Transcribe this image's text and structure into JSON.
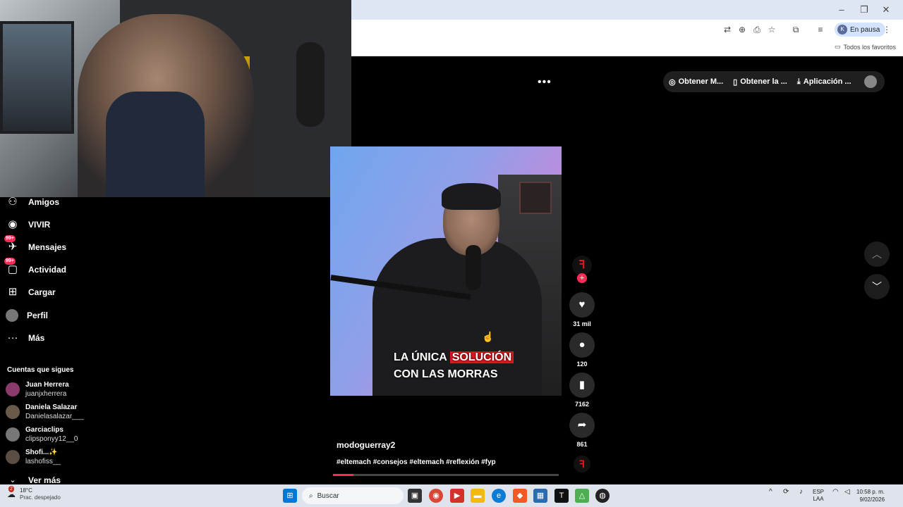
{
  "browser": {
    "pause_label": "En pausa",
    "pause_avatar": "K",
    "favorites_label": "Todos los favoritos",
    "window_controls": {
      "minimize": "–",
      "maximize": "❐",
      "close": "✕"
    },
    "toolbar_icons": [
      "translate-icon",
      "zoom-icon",
      "install-icon",
      "star-icon",
      "extensions-icon",
      "media-icon",
      "menu-icon"
    ]
  },
  "header": {
    "more_label": "•••",
    "buttons": [
      {
        "label": "Obtener M...",
        "icon": "coin-icon"
      },
      {
        "label": "Obtener la ...",
        "icon": "phone-icon"
      },
      {
        "label": "Aplicación ...",
        "icon": "download-icon"
      }
    ]
  },
  "sidebar": {
    "items": [
      {
        "label": "Amigos",
        "icon": "friends-icon"
      },
      {
        "label": "VIVIR",
        "icon": "live-icon"
      },
      {
        "label": "Mensajes",
        "icon": "messages-icon",
        "badge": "99+"
      },
      {
        "label": "Actividad",
        "icon": "activity-icon",
        "badge": "99+"
      },
      {
        "label": "Cargar",
        "icon": "upload-icon"
      },
      {
        "label": "Perfil",
        "icon": "profile-icon"
      },
      {
        "label": "Más",
        "icon": "more-icon"
      }
    ],
    "following_title": "Cuentas que sigues",
    "following": [
      {
        "name": "Juan Herrera",
        "user": "juanjxherrera"
      },
      {
        "name": "Daniela Salazar",
        "user": "Danielasalazar___"
      },
      {
        "name": "Garciaclips",
        "user": "clipsponyy12__0"
      },
      {
        "name": "Shofi...✨",
        "user": "lashofiss__"
      }
    ],
    "see_more": "Ver más"
  },
  "video": {
    "caption_line1_a": "LA ÚNICA",
    "caption_line1_b": "SOLUCIÓN",
    "caption_line2": "CON LAS MORRAS",
    "author": "modoguerray2",
    "tags": "#eltemach #consejos #eltemach #reflexión #fyp",
    "progress": 0.09
  },
  "actions": {
    "likes": "31 mil",
    "comments": "120",
    "saves": "7162",
    "shares": "861"
  },
  "taskbar": {
    "weather_badge": "2",
    "temperature": "18°C",
    "weather_desc": "Prac. despejado",
    "search_label": "Buscar",
    "lang_top": "ESP",
    "lang_bottom": "LAA",
    "time": "10:58 p. m.",
    "date": "9/02/2026"
  },
  "colors": {
    "accent": "#fe2c55",
    "caption_highlight": "#e0171e",
    "taskbar": "#dfe4ec"
  }
}
